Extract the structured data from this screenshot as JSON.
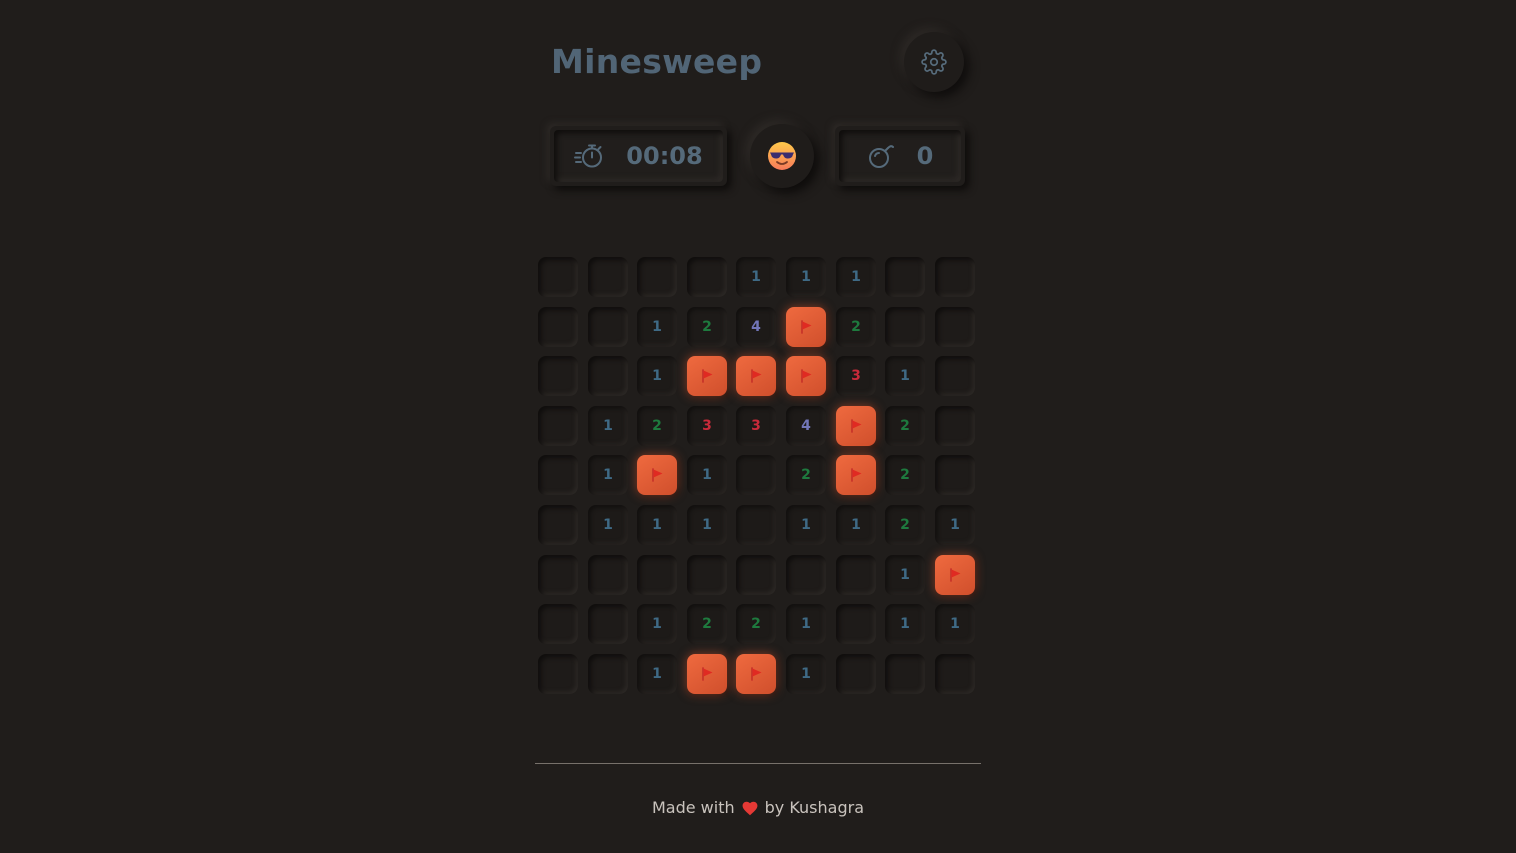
{
  "header": {
    "title": "Minesweep",
    "settings_icon": "gear-icon"
  },
  "timer": {
    "icon": "fast-stopwatch-icon",
    "value": "00:08"
  },
  "face": {
    "icon": "sunglasses-face-icon"
  },
  "mines": {
    "icon": "bomb-icon",
    "value": "0"
  },
  "board": {
    "rows": 9,
    "cols": 9,
    "legend": "C = covered, F = flagged, 0 = open empty, 1-4 = open with adjacent-mine count",
    "cells": [
      [
        "C",
        "C",
        "C",
        "C",
        "1",
        "1",
        "1",
        "C",
        "C"
      ],
      [
        "C",
        "C",
        "1",
        "2",
        "4",
        "F",
        "2",
        "C",
        "C"
      ],
      [
        "C",
        "C",
        "1",
        "F",
        "F",
        "F",
        "3",
        "1",
        "C"
      ],
      [
        "C",
        "1",
        "2",
        "3",
        "3",
        "4",
        "F",
        "2",
        "C"
      ],
      [
        "C",
        "1",
        "F",
        "1",
        "0",
        "2",
        "F",
        "2",
        "C"
      ],
      [
        "C",
        "1",
        "1",
        "1",
        "0",
        "1",
        "1",
        "2",
        "1"
      ],
      [
        "C",
        "C",
        "C",
        "C",
        "C",
        "C",
        "C",
        "1",
        "F"
      ],
      [
        "C",
        "C",
        "1",
        "2",
        "2",
        "1",
        "C",
        "1",
        "1"
      ],
      [
        "C",
        "C",
        "1",
        "F",
        "F",
        "1",
        "C",
        "C",
        "C"
      ]
    ],
    "flag_icon": "flag-icon"
  },
  "colors": {
    "background": "#201d1b",
    "title": "#516576",
    "flag_tile": "#e8623a",
    "number_1": "#3f6a85",
    "number_2": "#1e7a3e",
    "number_3": "#c92a3a",
    "number_4": "#7276b8",
    "heart": "#e53935"
  },
  "footer": {
    "text_before": "Made with",
    "heart_icon": "heart-icon",
    "text_after": "by Kushagra"
  }
}
